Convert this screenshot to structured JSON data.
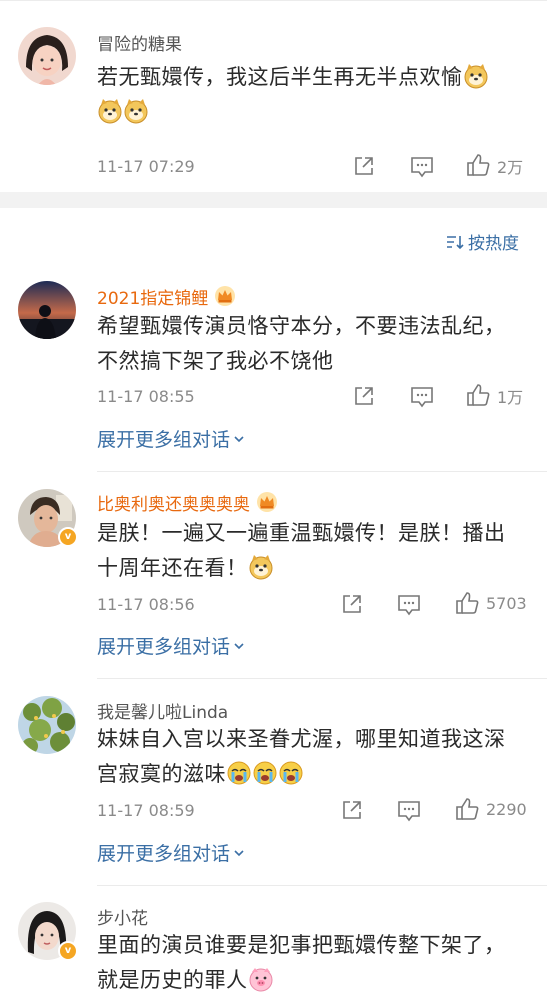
{
  "sort": {
    "label": "按热度"
  },
  "expand_label": "展开更多组对话",
  "colors": {
    "link": "#3b6fa5",
    "vip_name": "#e8690f",
    "meta": "#8a8a8a"
  },
  "comments": [
    {
      "user": "冒险的糖果",
      "text": "若无甄嬛传，我这后半生再无半点欢愉",
      "emojis": [
        "doge",
        "doge",
        "doge"
      ],
      "time": "11-17 07:29",
      "likes": "2万"
    },
    {
      "user": "2021指定锦鲤",
      "badge": "crown-icon",
      "text": "希望甄嬛传演员恪守本分，不要违法乱纪，不然搞下架了我必不饶他",
      "time": "11-17 08:55",
      "likes": "1万"
    },
    {
      "user": "比奥利奥还奥奥奥奥",
      "badge": "crown-icon",
      "verified": true,
      "text": "是朕！一遍又一遍重温甄嬛传！是朕！播出十周年还在看！",
      "emojis": [
        "doge"
      ],
      "time": "11-17 08:56",
      "likes": "5703"
    },
    {
      "user": "我是馨儿啦Linda",
      "text": "妹妹自入宫以来圣眷尤渥，哪里知道我这深宫寂寞的滋味",
      "emojis": [
        "cry",
        "cry",
        "cry"
      ],
      "time": "11-17 08:59",
      "likes": "2290"
    },
    {
      "user": "步小花",
      "verified": true,
      "text": "里面的演员谁要是犯事把甄嬛传整下架了，就是历史的罪人",
      "emojis": [
        "pig"
      ]
    }
  ]
}
